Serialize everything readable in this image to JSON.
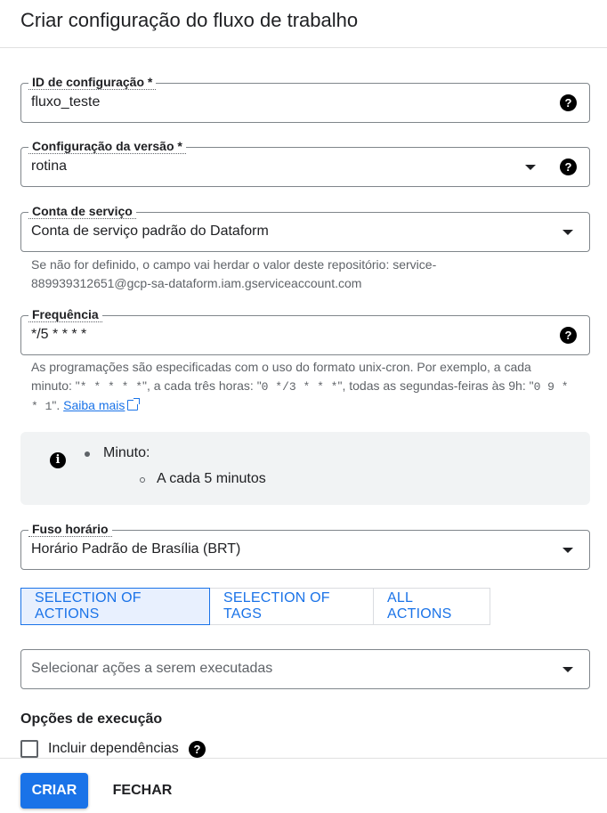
{
  "dialog": {
    "title": "Criar configuração do fluxo de trabalho"
  },
  "config_id": {
    "label": "ID de configuração *",
    "value": "fluxo_teste",
    "help_icon": "help-circle-icon"
  },
  "version_config": {
    "label": "Configuração da versão *",
    "value": "rotina",
    "dropdown_icon": "caret-down-icon",
    "help_icon": "help-circle-icon"
  },
  "service_account": {
    "label": "Conta de serviço",
    "value": "Conta de serviço padrão do Dataform",
    "hint_line1": "Se não for definido, o campo vai herdar o valor deste repositório: service-",
    "hint_line2": "889939312651@gcp-sa-dataform.iam.gserviceaccount.com"
  },
  "frequency": {
    "label": "Frequência",
    "value": "*/5 * * * *",
    "hint_part1": "As programações são especificadas com o uso do formato unix-cron. Por exemplo, a cada minuto: \"",
    "hint_code1": "* * * * *",
    "hint_part2": "\", a cada três horas: \"",
    "hint_code2": "0 */3 * * *",
    "hint_part3": "\", todas as segundas-feiras às 9h: \"",
    "hint_code3": "0 9 * * 1",
    "hint_part4": "\". ",
    "learn_more": "Saiba mais"
  },
  "schedule_info": {
    "icon": "info-icon",
    "item": "Minuto:",
    "subitem": "A cada 5 minutos"
  },
  "timezone": {
    "label": "Fuso horário",
    "value": "Horário Padrão de Brasília (BRT)"
  },
  "tabs": [
    {
      "label": "SELECTION OF ACTIONS",
      "selected": true
    },
    {
      "label": "SELECTION OF TAGS",
      "selected": false
    },
    {
      "label": "ALL ACTIONS",
      "selected": false
    }
  ],
  "actions_select": {
    "placeholder": "Selecionar ações a serem executadas"
  },
  "execution_options": {
    "title": "Opções de execução",
    "include_dependencies": "Incluir dependências",
    "checked": false
  },
  "footer": {
    "create_label": "CRIAR",
    "close_label": "FECHAR"
  },
  "colors": {
    "accent": "#1a73e8",
    "selected_tab_bg": "#e8f0fe",
    "info_bg": "#f1f3f4"
  }
}
